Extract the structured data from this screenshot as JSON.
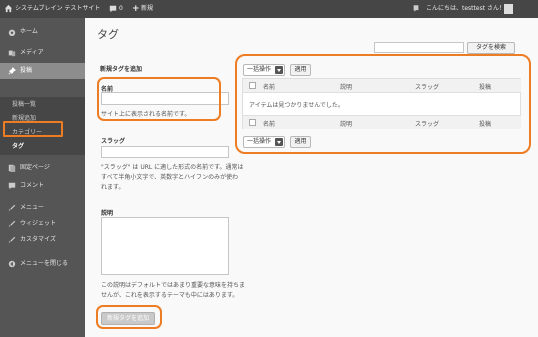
{
  "adminbar": {
    "site_name": "システムブレイン テストサイト",
    "comments_count": "0",
    "new_label": "新規",
    "greeting": "こんにちは、testtest さん！"
  },
  "menu": {
    "items": [
      {
        "label": "ホーム",
        "icon": "home-icon"
      },
      {
        "label": "メディア",
        "icon": "media-icon"
      },
      {
        "label": "投稿",
        "icon": "pin-icon"
      },
      {
        "label": "固定ページ",
        "icon": "page-icon"
      },
      {
        "label": "コメント",
        "icon": "comment-icon"
      },
      {
        "label": "メニュー",
        "icon": "menu-icon"
      },
      {
        "label": "ウィジェット",
        "icon": "widget-icon"
      },
      {
        "label": "カスタマイズ",
        "icon": "customize-icon"
      },
      {
        "label": "メニューを閉じる",
        "icon": "collapse-icon"
      }
    ],
    "submenu": [
      "投稿一覧",
      "新規追加",
      "カテゴリー",
      "タグ"
    ]
  },
  "page": {
    "title": "タグ",
    "search_button": "タグを検索"
  },
  "form": {
    "heading": "新規タグを追加",
    "name_label": "名前",
    "name_value": "",
    "name_help": "サイト上に表示される名前です。",
    "slug_label": "スラッグ",
    "slug_value": "",
    "slug_help_1": "\"スラッグ\" は URL に適した形式の名前です。通常は",
    "slug_help_2": "すべて半角小文字で、英数字とハイフンのみが使わ",
    "slug_help_3": "れます。",
    "desc_label": "説明",
    "desc_help_1": "この説明はデフォルトではあまり重要な意味を持ちま",
    "desc_help_2": "せんが、これを表示するテーマも中にはあります。",
    "submit": "新規タグを追加"
  },
  "table": {
    "bulk_action": "一括操作",
    "apply": "適用",
    "columns": [
      "名前",
      "説明",
      "スラッグ",
      "投稿"
    ],
    "empty_message": "アイテムは見つかりませんでした。"
  }
}
